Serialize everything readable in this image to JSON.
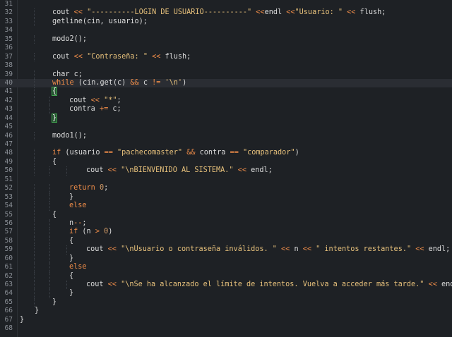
{
  "editor": {
    "theme": {
      "background": "#1e2125",
      "text": "#dcdcdc",
      "keyword": "#f08d49",
      "string": "#e6c07b",
      "line_number": "#8a8f96",
      "brace_highlight": "#3fa34d"
    },
    "current_line": 40,
    "lines": [
      {
        "n": "31",
        "indent": 0,
        "tokens": []
      },
      {
        "n": "32",
        "indent": 2,
        "tokens": [
          [
            "plain",
            "cout "
          ],
          [
            "op",
            "<<"
          ],
          [
            "str",
            " \"----------LOGIN DE USUARIO----------\""
          ],
          [
            "plain",
            " "
          ],
          [
            "op",
            "<<"
          ],
          [
            "plain",
            "endl "
          ],
          [
            "op",
            "<<"
          ],
          [
            "str",
            "\"Usuario: \""
          ],
          [
            "plain",
            " "
          ],
          [
            "op",
            "<<"
          ],
          [
            "plain",
            " flush;"
          ]
        ]
      },
      {
        "n": "33",
        "indent": 2,
        "tokens": [
          [
            "plain",
            "getline(cin, usuario);"
          ]
        ]
      },
      {
        "n": "34",
        "indent": 0,
        "tokens": []
      },
      {
        "n": "35",
        "indent": 2,
        "tokens": [
          [
            "plain",
            "modo2();"
          ]
        ]
      },
      {
        "n": "36",
        "indent": 0,
        "tokens": []
      },
      {
        "n": "37",
        "indent": 2,
        "tokens": [
          [
            "plain",
            "cout "
          ],
          [
            "op",
            "<<"
          ],
          [
            "str",
            " \"Contraseña: \""
          ],
          [
            "plain",
            " "
          ],
          [
            "op",
            "<<"
          ],
          [
            "plain",
            " flush;"
          ]
        ]
      },
      {
        "n": "38",
        "indent": 0,
        "tokens": []
      },
      {
        "n": "39",
        "indent": 2,
        "tokens": [
          [
            "plain",
            "char c;"
          ]
        ]
      },
      {
        "n": "40",
        "indent": 2,
        "tokens": [
          [
            "kw",
            "while"
          ],
          [
            "plain",
            " (cin.get(c) "
          ],
          [
            "op",
            "&&"
          ],
          [
            "plain",
            " c "
          ],
          [
            "op",
            "!="
          ],
          [
            "plain",
            " "
          ],
          [
            "str",
            "'\\n'"
          ],
          [
            "plain",
            ")"
          ]
        ]
      },
      {
        "n": "41",
        "indent": 2,
        "tokens": [
          [
            "brace",
            "{"
          ]
        ]
      },
      {
        "n": "42",
        "indent": 3,
        "tokens": [
          [
            "plain",
            "cout "
          ],
          [
            "op",
            "<<"
          ],
          [
            "plain",
            " "
          ],
          [
            "str",
            "\"*\""
          ],
          [
            "plain",
            ";"
          ]
        ]
      },
      {
        "n": "43",
        "indent": 3,
        "tokens": [
          [
            "plain",
            "contra "
          ],
          [
            "op",
            "+="
          ],
          [
            "plain",
            " c;"
          ]
        ]
      },
      {
        "n": "44",
        "indent": 2,
        "tokens": [
          [
            "brace",
            "}"
          ]
        ]
      },
      {
        "n": "45",
        "indent": 0,
        "tokens": []
      },
      {
        "n": "46",
        "indent": 2,
        "tokens": [
          [
            "plain",
            "modo1();"
          ]
        ]
      },
      {
        "n": "47",
        "indent": 0,
        "tokens": []
      },
      {
        "n": "48",
        "indent": 2,
        "tokens": [
          [
            "kw",
            "if"
          ],
          [
            "plain",
            " (usuario "
          ],
          [
            "op",
            "=="
          ],
          [
            "plain",
            " "
          ],
          [
            "str",
            "\"pachecomaster\""
          ],
          [
            "plain",
            " "
          ],
          [
            "op",
            "&&"
          ],
          [
            "plain",
            " contra "
          ],
          [
            "op",
            "=="
          ],
          [
            "plain",
            " "
          ],
          [
            "str",
            "\"comparador\""
          ],
          [
            "plain",
            ")"
          ]
        ]
      },
      {
        "n": "49",
        "indent": 2,
        "tokens": [
          [
            "plain",
            "{"
          ]
        ]
      },
      {
        "n": "50",
        "indent": 4,
        "tokens": [
          [
            "plain",
            "cout "
          ],
          [
            "op",
            "<<"
          ],
          [
            "plain",
            " "
          ],
          [
            "str",
            "\"\\nBIENVENIDO AL SISTEMA.\""
          ],
          [
            "plain",
            " "
          ],
          [
            "op",
            "<<"
          ],
          [
            "plain",
            " endl;"
          ]
        ]
      },
      {
        "n": "51",
        "indent": 0,
        "tokens": []
      },
      {
        "n": "52",
        "indent": 3,
        "tokens": [
          [
            "kw",
            "return"
          ],
          [
            "plain",
            " "
          ],
          [
            "num",
            "0"
          ],
          [
            "plain",
            ";"
          ]
        ]
      },
      {
        "n": "53",
        "indent": 3,
        "tokens": [
          [
            "plain",
            "}"
          ]
        ]
      },
      {
        "n": "54",
        "indent": 3,
        "tokens": [
          [
            "kw",
            "else"
          ]
        ]
      },
      {
        "n": "55",
        "indent": 2,
        "tokens": [
          [
            "plain",
            "{"
          ]
        ]
      },
      {
        "n": "56",
        "indent": 3,
        "tokens": [
          [
            "plain",
            "n"
          ],
          [
            "op",
            "--"
          ],
          [
            "plain",
            ";"
          ]
        ]
      },
      {
        "n": "57",
        "indent": 3,
        "tokens": [
          [
            "kw",
            "if"
          ],
          [
            "plain",
            " (n "
          ],
          [
            "op",
            ">"
          ],
          [
            "plain",
            " "
          ],
          [
            "num",
            "0"
          ],
          [
            "plain",
            ")"
          ]
        ]
      },
      {
        "n": "58",
        "indent": 3,
        "tokens": [
          [
            "plain",
            "{"
          ]
        ]
      },
      {
        "n": "59",
        "indent": 4,
        "tokens": [
          [
            "plain",
            "cout "
          ],
          [
            "op",
            "<<"
          ],
          [
            "plain",
            " "
          ],
          [
            "str",
            "\"\\nUsuario o contraseña inválidos. \""
          ],
          [
            "plain",
            " "
          ],
          [
            "op",
            "<<"
          ],
          [
            "plain",
            " n "
          ],
          [
            "op",
            "<<"
          ],
          [
            "plain",
            " "
          ],
          [
            "str",
            "\" intentos restantes.\""
          ],
          [
            "plain",
            " "
          ],
          [
            "op",
            "<<"
          ],
          [
            "plain",
            " endl;"
          ]
        ]
      },
      {
        "n": "60",
        "indent": 3,
        "tokens": [
          [
            "plain",
            "}"
          ]
        ]
      },
      {
        "n": "61",
        "indent": 3,
        "tokens": [
          [
            "kw",
            "else"
          ]
        ]
      },
      {
        "n": "62",
        "indent": 3,
        "tokens": [
          [
            "plain",
            "{"
          ]
        ]
      },
      {
        "n": "63",
        "indent": 4,
        "tokens": [
          [
            "plain",
            "cout "
          ],
          [
            "op",
            "<<"
          ],
          [
            "plain",
            " "
          ],
          [
            "str",
            "\"\\nSe ha alcanzado el límite de intentos. Vuelva a acceder más tarde.\""
          ],
          [
            "plain",
            " "
          ],
          [
            "op",
            "<<"
          ],
          [
            "plain",
            " endl;"
          ]
        ]
      },
      {
        "n": "64",
        "indent": 3,
        "tokens": [
          [
            "plain",
            "}"
          ]
        ]
      },
      {
        "n": "65",
        "indent": 2,
        "tokens": [
          [
            "plain",
            "}"
          ]
        ]
      },
      {
        "n": "66",
        "indent": 1,
        "tokens": [
          [
            "plain",
            "}"
          ]
        ]
      },
      {
        "n": "67",
        "indent": 0,
        "tokens": [
          [
            "plain",
            "}"
          ]
        ]
      },
      {
        "n": "68",
        "indent": 0,
        "tokens": []
      }
    ]
  }
}
